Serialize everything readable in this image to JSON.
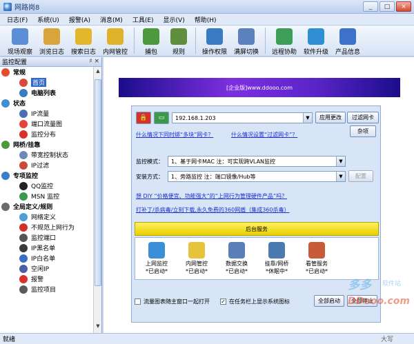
{
  "window": {
    "title": "网路岗8"
  },
  "menu": [
    "日志(F)",
    "系统(U)",
    "报警(A)",
    "消息(M)",
    "工具(E)",
    "显示(V)",
    "帮助(H)"
  ],
  "toolbar": [
    {
      "label": "现场观察",
      "icon": "eye-icon",
      "color": "#5a8ed6"
    },
    {
      "label": "浏览日志",
      "icon": "browse-log-icon",
      "color": "#d9a43a"
    },
    {
      "label": "搜索日志",
      "icon": "search-log-icon",
      "color": "#e3b62c"
    },
    {
      "label": "内网管控",
      "icon": "intranet-control-icon",
      "color": "#e0b22a"
    },
    {
      "label": "捕包",
      "icon": "capture-icon",
      "color": "#4c9a3d"
    },
    {
      "label": "规则",
      "icon": "rules-icon",
      "color": "#5f8f3c"
    },
    {
      "label": "操作权限",
      "icon": "permission-icon",
      "color": "#3a7cc4"
    },
    {
      "label": "满屏切换",
      "icon": "fullscreen-icon",
      "color": "#5b82bd"
    },
    {
      "label": "远程协助",
      "icon": "remote-assist-icon",
      "color": "#3d9e58"
    },
    {
      "label": "软件升级",
      "icon": "upgrade-icon",
      "color": "#2f8fd2"
    },
    {
      "label": "产品信息",
      "icon": "info-icon",
      "color": "#3c73c8"
    }
  ],
  "leftpanel": {
    "title": "监控配置",
    "pin": "♯ ×",
    "tree": [
      {
        "type": "grp",
        "label": "常规",
        "color": "#e44d2e"
      },
      {
        "type": "leaf",
        "label": "首页",
        "color": "#d94a3a",
        "selected": true
      },
      {
        "type": "leaf",
        "label": "电脑列表",
        "color": "#3a7cc4",
        "bold": true
      },
      {
        "type": "grp",
        "label": "状态",
        "color": "#3e8ed0"
      },
      {
        "type": "leaf",
        "label": "IP流量",
        "color": "#4a6fb5"
      },
      {
        "type": "leaf",
        "label": "端口流量图",
        "color": "#e1443a"
      },
      {
        "type": "leaf",
        "label": "监控分布",
        "color": "#d9302a"
      },
      {
        "type": "grp",
        "label": "网桥/挂靠",
        "color": "#4d9a3c"
      },
      {
        "type": "leaf",
        "label": "带宽控制状态",
        "color": "#6d89b6"
      },
      {
        "type": "leaf",
        "label": "IP过滤",
        "color": "#c94b3a"
      },
      {
        "type": "grp",
        "label": "专项监控",
        "color": "#3b7ec9"
      },
      {
        "type": "leaf",
        "label": "QQ监控",
        "color": "#222222"
      },
      {
        "type": "leaf",
        "label": "MSN 监控",
        "color": "#3a9a4a"
      },
      {
        "type": "grp",
        "label": "全局定义/规则",
        "color": "#6a6a6a"
      },
      {
        "type": "leaf",
        "label": "网络定义",
        "color": "#4b9fd5"
      },
      {
        "type": "leaf",
        "label": "不规范上网行为",
        "color": "#d2302a"
      },
      {
        "type": "leaf",
        "label": "监控端口",
        "color": "#555555"
      },
      {
        "type": "leaf",
        "label": "IP黑名单",
        "color": "#3a3a3a"
      },
      {
        "type": "leaf",
        "label": "IP白名单",
        "color": "#3a6fc4"
      },
      {
        "type": "leaf",
        "label": "空闲IP",
        "color": "#4a5fa6"
      },
      {
        "type": "leaf",
        "label": "报警",
        "color": "#d9302a"
      },
      {
        "type": "leaf",
        "label": "监控项目",
        "color": "#5a5a5a"
      }
    ]
  },
  "main": {
    "banner": "[企业版]www.ddooo.com",
    "ip_value": "192.168.1.203",
    "btn_app_change": "应用更改",
    "btn_filter_nic": "过滤网卡",
    "btn_misc": "杂项",
    "link_multi_nic": "什么情况下同时绑“多块”网卡？",
    "link_filter_nic": "什么情况设置“过滤网卡”？",
    "mode_label": "监控模式：",
    "mode_value": "1、基于网卡MAC    注：可实现跨VLAN监控",
    "install_label": "安装方式：",
    "install_value": "1、旁路监控    注：端口镜像/Hub等",
    "btn_config": "配置",
    "link_hw": "想 DIY “价格便宜、功能强大”的“上网行为管理硬件产品”吗？",
    "link_360": "打补丁/杀病毒/立刻下载,永久免费的360网盾（集成360杀毒）",
    "service_title": "后台服务",
    "services": [
      {
        "line1": "上网监控",
        "line2": "*已启动*",
        "color": "#3a8fd6",
        "icon": "globe-service-icon"
      },
      {
        "line1": "内网管控",
        "line2": "*已启动*",
        "color": "#e6c33a",
        "icon": "intranet-service-icon"
      },
      {
        "line1": "数据交换",
        "line2": "*已启动*",
        "color": "#5a7fb8",
        "icon": "exchange-service-icon"
      },
      {
        "line1": "挂靠/网桥",
        "line2": "*休眠中*",
        "color": "#4a7ab0",
        "icon": "bridge-service-icon"
      },
      {
        "line1": "看管服务",
        "line2": "*已启动*",
        "color": "#c85a3a",
        "icon": "guard-service-icon"
      }
    ],
    "chk_traffic": "流量图表随主窗口一起打开",
    "chk_tray": "在任务栏上显示系统图标",
    "chk_tray_checked": "✓",
    "btn_start_all": "全部启动",
    "btn_stop_all": "全部停止",
    "watermark_1": "多多",
    "watermark_2": "软件站",
    "watermark_3": "DDooo.com"
  },
  "status": {
    "text": "就绪",
    "right": "大写"
  }
}
